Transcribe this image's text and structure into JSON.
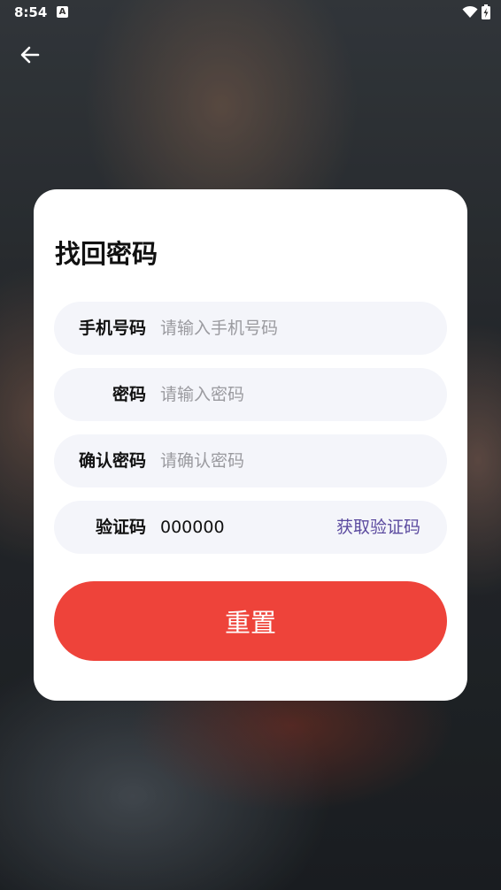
{
  "status_bar": {
    "time": "8:54",
    "notification_badge": "A"
  },
  "page": {
    "title": "找回密码"
  },
  "form": {
    "phone": {
      "label": "手机号码",
      "placeholder": "请输入手机号码"
    },
    "password": {
      "label": "密码",
      "placeholder": "请输入密码"
    },
    "confirm_password": {
      "label": "确认密码",
      "placeholder": "请确认密码"
    },
    "code": {
      "label": "验证码",
      "value": "000000",
      "get_code_label": "获取验证码"
    }
  },
  "reset_button": {
    "label": "重置"
  },
  "colors": {
    "accent": "#ee433a",
    "link": "#5b4a9f",
    "field_bg": "#f4f5fa"
  },
  "icons": {
    "back": "arrow-left-icon",
    "wifi": "wifi-icon",
    "battery": "battery-charging-icon"
  }
}
